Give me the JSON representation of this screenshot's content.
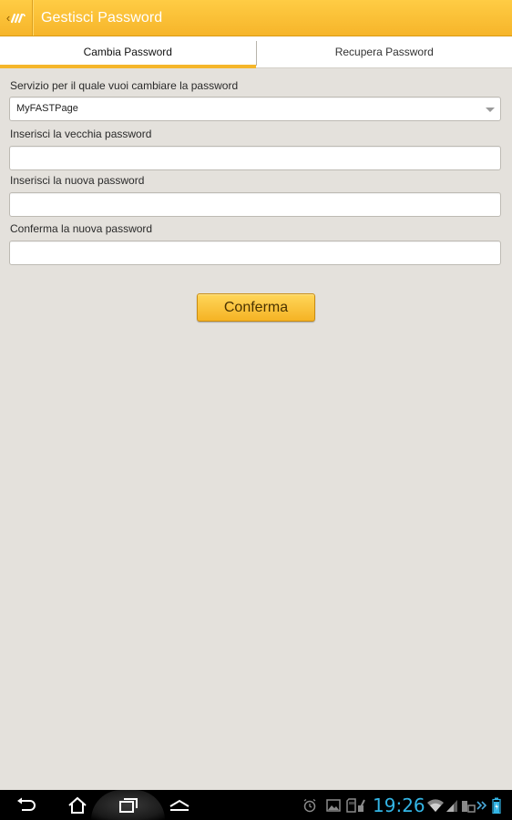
{
  "header": {
    "title": "Gestisci Password",
    "up_icon": "chevron-left-icon",
    "logo_icon": "app-logo-icon"
  },
  "tabs": [
    {
      "label": "Cambia Password",
      "active": true
    },
    {
      "label": "Recupera Password",
      "active": false
    }
  ],
  "form": {
    "service_label": "Servizio per il quale vuoi cambiare la password",
    "service_value": "MyFASTPage",
    "old_password_label": "Inserisci la vecchia password",
    "old_password_value": "",
    "new_password_label": "Inserisci la nuova password",
    "new_password_value": "",
    "confirm_password_label": "Conferma la nuova password",
    "confirm_password_value": "",
    "confirm_button": "Conferma"
  },
  "system_bar": {
    "time": "19:26",
    "nav": [
      "back-icon",
      "home-icon",
      "recent-apps-icon",
      "menu-icon"
    ],
    "status_icons": [
      "alarm-icon",
      "gallery-icon",
      "sd-card-icon",
      "wifi-icon",
      "signal-icon",
      "battery-icon"
    ]
  },
  "colors": {
    "accent": "#f5b62a",
    "clock": "#33b5e5",
    "background": "#e4e1dc"
  }
}
